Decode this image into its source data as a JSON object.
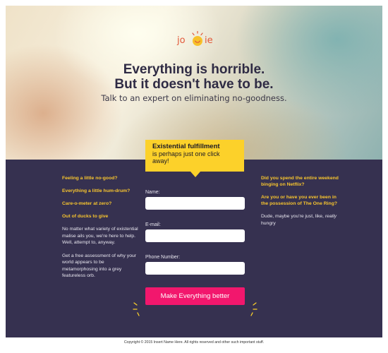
{
  "logo": {
    "left": "jo",
    "right": "ie",
    "sun_icon": "smiling-sun-icon"
  },
  "hero": {
    "headline_line1": "Everything is horrible.",
    "headline_line2": "But it doesn't have to be.",
    "subhead": "Talk to an expert on eliminating no-goodness."
  },
  "tooltip": {
    "title": "Existential fulfillment",
    "body": "is perhaps just one click away!"
  },
  "left_column": {
    "questions": [
      "Feeling a little no-good?",
      "Everything a little hum-drum?",
      "Care-o-meter at zero?",
      "Out of ducks to give"
    ],
    "paragraph1": "No matter what variety of existential malise ails you, we're here to help. Well, attempt to, anyway.",
    "paragraph2": "Get a free assessment of why your world appears to be metamorphosing into a grey featureless orb."
  },
  "right_column": {
    "questions": [
      "Did you spend the entire weekend binging on Netflix?",
      "Are you or have you ever been in the possession of The One Ring?"
    ],
    "note_prefix": "Dude, maybe you're just, like,",
    "note_emphasis": "really",
    "note_suffix": "hungry"
  },
  "form": {
    "name_label": "Name:",
    "email_label": "E-mail:",
    "phone_label": "Phone Number:",
    "name_value": "",
    "email_value": "",
    "phone_value": "",
    "submit_label": "Make Everything better"
  },
  "footer": {
    "text": "Copyright © 2015 Insert Name Here. All rights reserved and other such important stuff."
  },
  "colors": {
    "band": "#363150",
    "accent_yellow": "#fcd12a",
    "cta_pink": "#f2176d",
    "headline": "#2f2b44"
  }
}
